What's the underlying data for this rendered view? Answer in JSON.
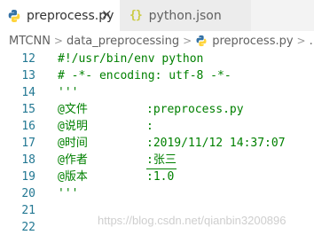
{
  "tabs": [
    {
      "label": "preprocess.py",
      "icon": "python-icon",
      "active": true
    },
    {
      "label": "python.json",
      "icon": "json-braces-icon",
      "active": false
    }
  ],
  "tab_close_glyph": "×",
  "json_icon_glyph": "{}",
  "breadcrumb": {
    "items": [
      "MTCNN",
      "data_preprocessing",
      "preprocess.py",
      "..."
    ],
    "separator": ">"
  },
  "editor": {
    "lines": [
      {
        "number": "12",
        "text": "#!/usr/bin/env python"
      },
      {
        "number": "13",
        "text": "# -*- encoding: utf-8 -*-"
      },
      {
        "number": "14",
        "text": "'''"
      },
      {
        "number": "15",
        "key": "@文件",
        "value": ":preprocess.py"
      },
      {
        "number": "16",
        "key": "@说明",
        "value": ":"
      },
      {
        "number": "17",
        "key": "@时间",
        "value": ":2019/11/12 14:37:07"
      },
      {
        "number": "18",
        "key": "@作者",
        "value": ":张三"
      },
      {
        "number": "19",
        "key": "@版本",
        "value": ":1.0"
      },
      {
        "number": "20",
        "text": "'''"
      },
      {
        "number": "21",
        "text": ""
      },
      {
        "number": "22",
        "text": ""
      }
    ]
  },
  "watermark": "https://blog.csdn.net/qianbin3200896",
  "colors": {
    "code_green": "#008000",
    "line_number": "#237893",
    "tab_bar": "#f3f3f3",
    "python_blue": "#3572A5",
    "python_yellow": "#FFD43B",
    "json_yellow": "#cbcb41"
  }
}
